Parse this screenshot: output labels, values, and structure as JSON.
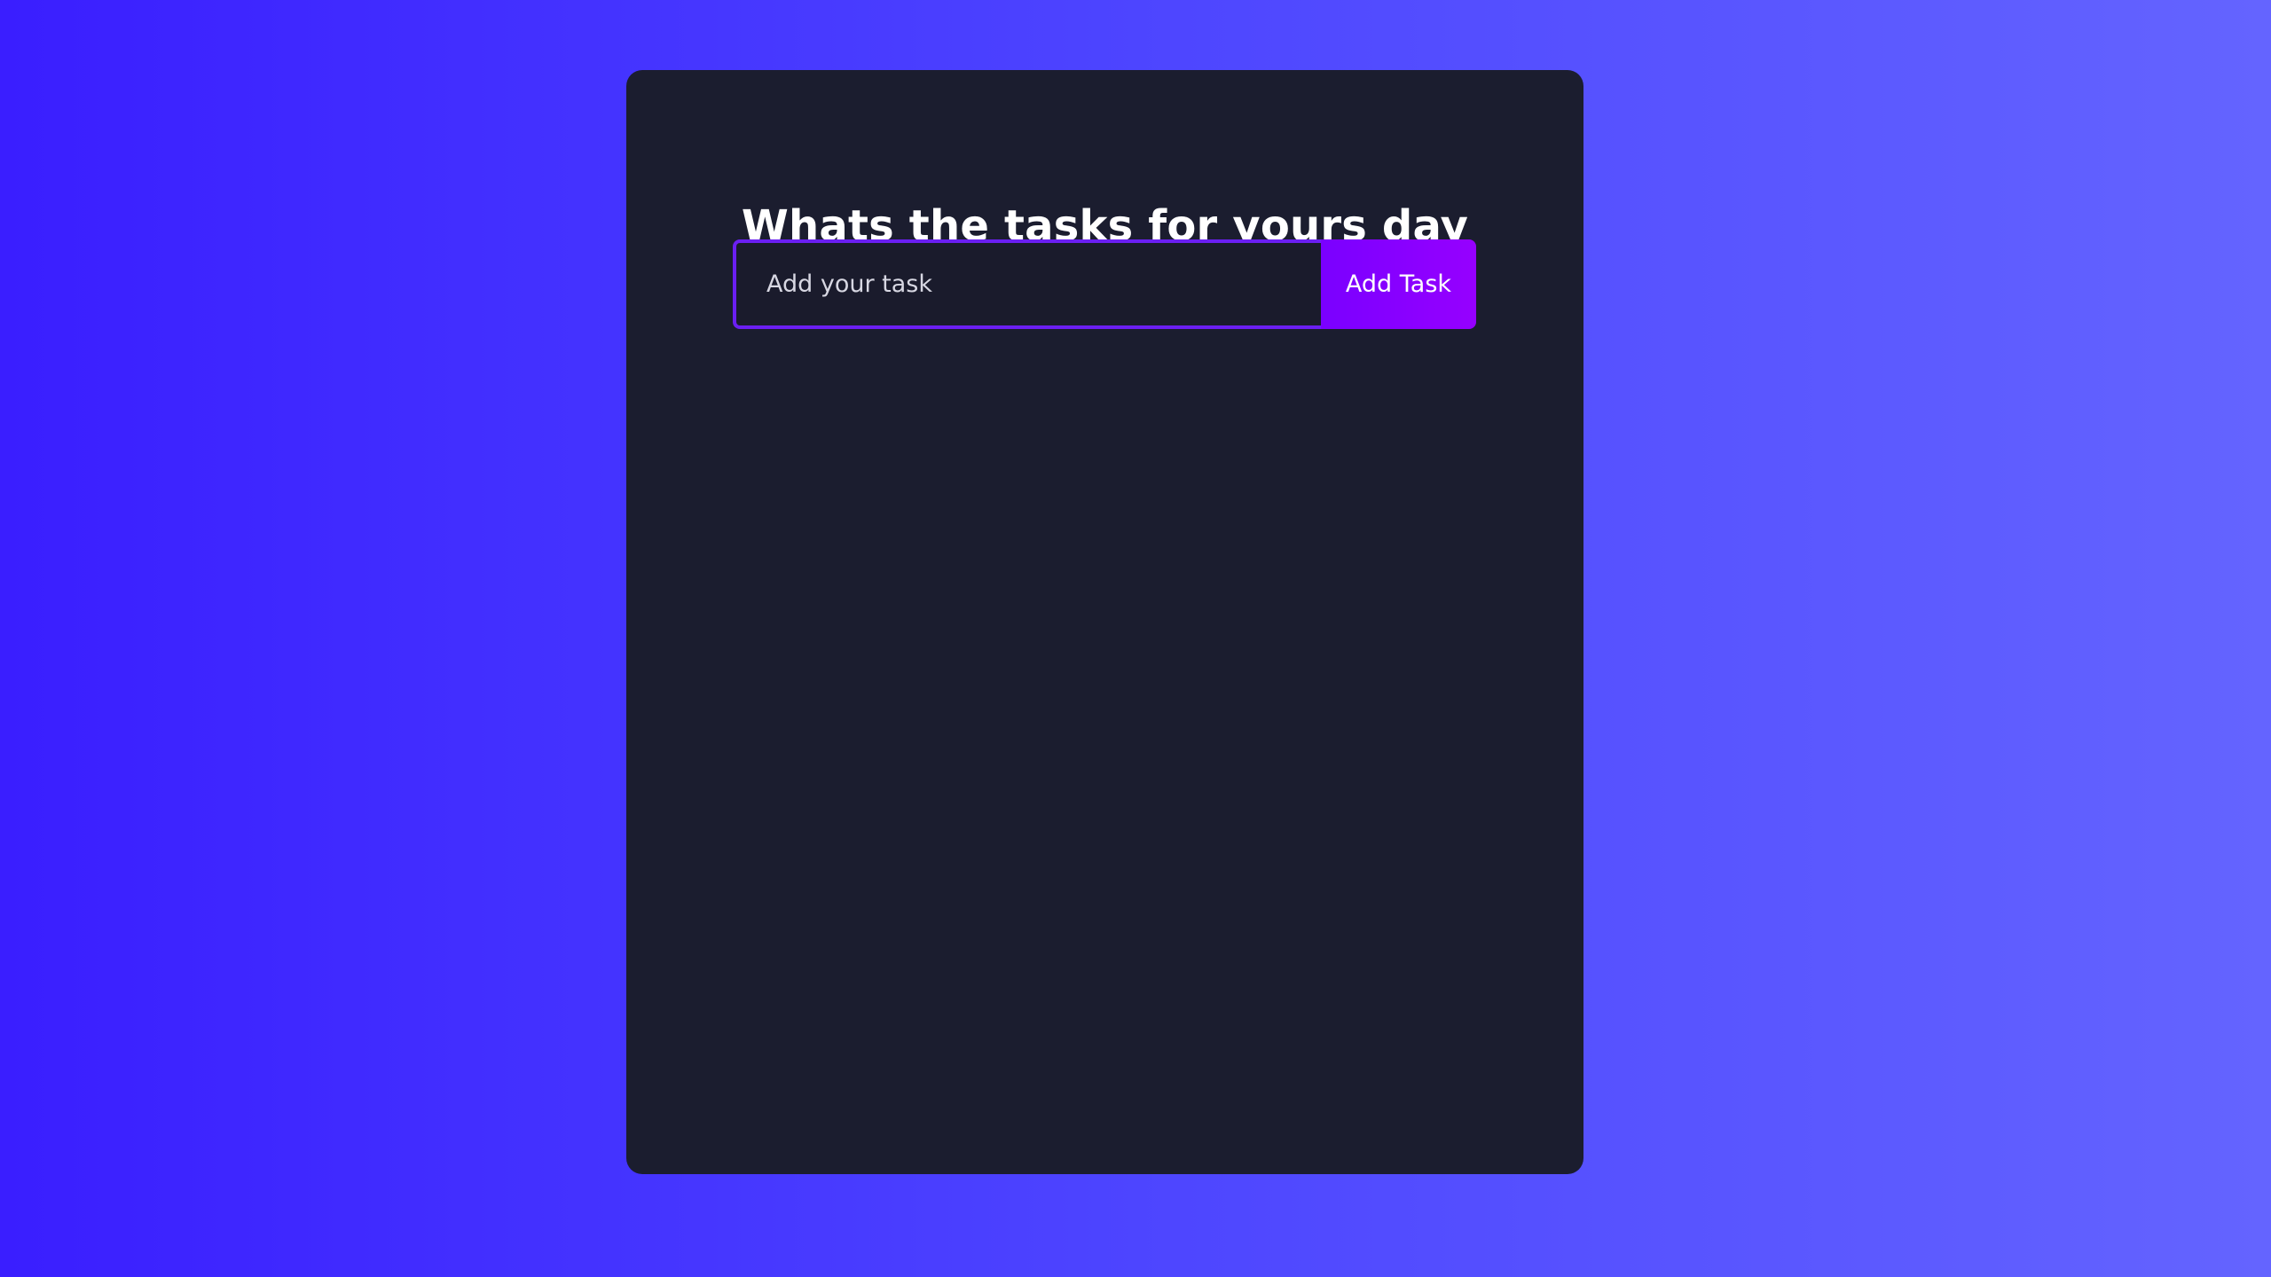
{
  "card": {
    "title": "Whats the tasks for yours day",
    "input": {
      "placeholder": "Add your task",
      "value": ""
    },
    "add_button_label": "Add Task",
    "tasks": []
  },
  "colors": {
    "background_gradient_start": "#3a1eff",
    "background_gradient_end": "#6464ff",
    "card_background": "#1b1d2f",
    "accent": "#7a00ff",
    "input_border": "#6b1ff2",
    "text": "#ffffff"
  }
}
